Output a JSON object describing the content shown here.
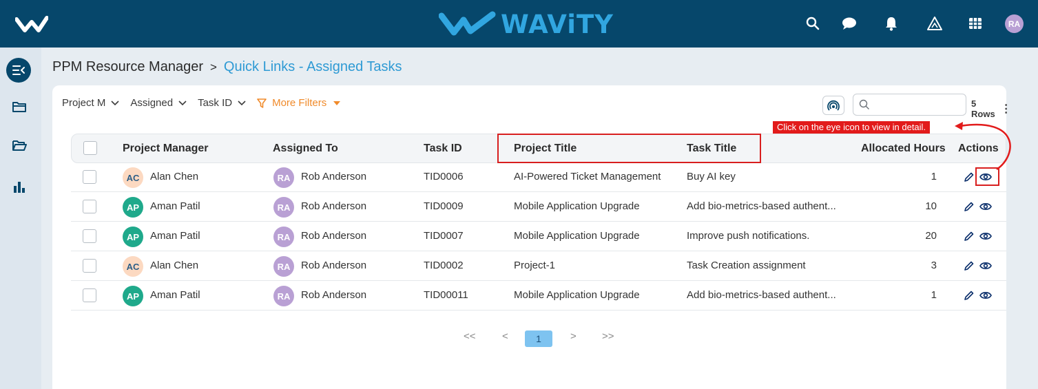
{
  "topbar": {
    "brand": "WAViTY",
    "user_initials": "RA",
    "icons": [
      "search-icon",
      "chat-icon",
      "bell-icon",
      "alert-triangle-icon",
      "grid-icon"
    ]
  },
  "sidebar": {
    "items": [
      "menu-toggle-icon",
      "folder-icon",
      "folder-open-icon",
      "bar-chart-icon"
    ]
  },
  "breadcrumb": {
    "root": "PPM Resource Manager",
    "separator": ">",
    "current": "Quick Links - Assigned Tasks"
  },
  "filters": {
    "items": [
      "Project M",
      "Assigned",
      "Task ID"
    ],
    "more_filters": "More Filters"
  },
  "search": {
    "placeholder": ""
  },
  "rows_label": "5 Rows",
  "table": {
    "headers": {
      "project_manager": "Project Manager",
      "assigned_to": "Assigned To",
      "task_id": "Task ID",
      "project_title": "Project Title",
      "task_title": "Task Title",
      "allocated_hours": "Allocated Hours",
      "actions": "Actions"
    },
    "rows": [
      {
        "pm_initials": "AC",
        "pm": "Alan Chen",
        "assignee_initials": "RA",
        "assignee": "Rob Anderson",
        "task_id": "TID0006",
        "project_title": "AI-Powered Ticket Management",
        "task_title": "Buy AI key",
        "hours": "1"
      },
      {
        "pm_initials": "AP",
        "pm": "Aman Patil",
        "assignee_initials": "RA",
        "assignee": "Rob Anderson",
        "task_id": "TID0009",
        "project_title": "Mobile Application Upgrade",
        "task_title": "Add bio-metrics-based authent...",
        "hours": "10"
      },
      {
        "pm_initials": "AP",
        "pm": "Aman Patil",
        "assignee_initials": "RA",
        "assignee": "Rob Anderson",
        "task_id": "TID0007",
        "project_title": "Mobile Application Upgrade",
        "task_title": "Improve push notifications.",
        "hours": "20"
      },
      {
        "pm_initials": "AC",
        "pm": "Alan Chen",
        "assignee_initials": "RA",
        "assignee": "Rob Anderson",
        "task_id": "TID0002",
        "project_title": "Project-1",
        "task_title": "Task Creation assignment",
        "hours": "3"
      },
      {
        "pm_initials": "AP",
        "pm": "Aman Patil",
        "assignee_initials": "RA",
        "assignee": "Rob Anderson",
        "task_id": "TID00011",
        "project_title": "Mobile Application Upgrade",
        "task_title": "Add bio-metrics-based authent...",
        "hours": "1"
      }
    ]
  },
  "pagination": {
    "first": "<<",
    "prev": "<",
    "current": "1",
    "next": ">",
    "last": ">>"
  },
  "annotation": {
    "callout": "Click on the eye icon to view in detail.",
    "color": "#e21b1b"
  },
  "colors": {
    "header_bg": "#06476b",
    "brand": "#31a6e0",
    "link": "#2e9ad4",
    "more_filters": "#f08a2a",
    "active_page": "#7ec3f0"
  }
}
